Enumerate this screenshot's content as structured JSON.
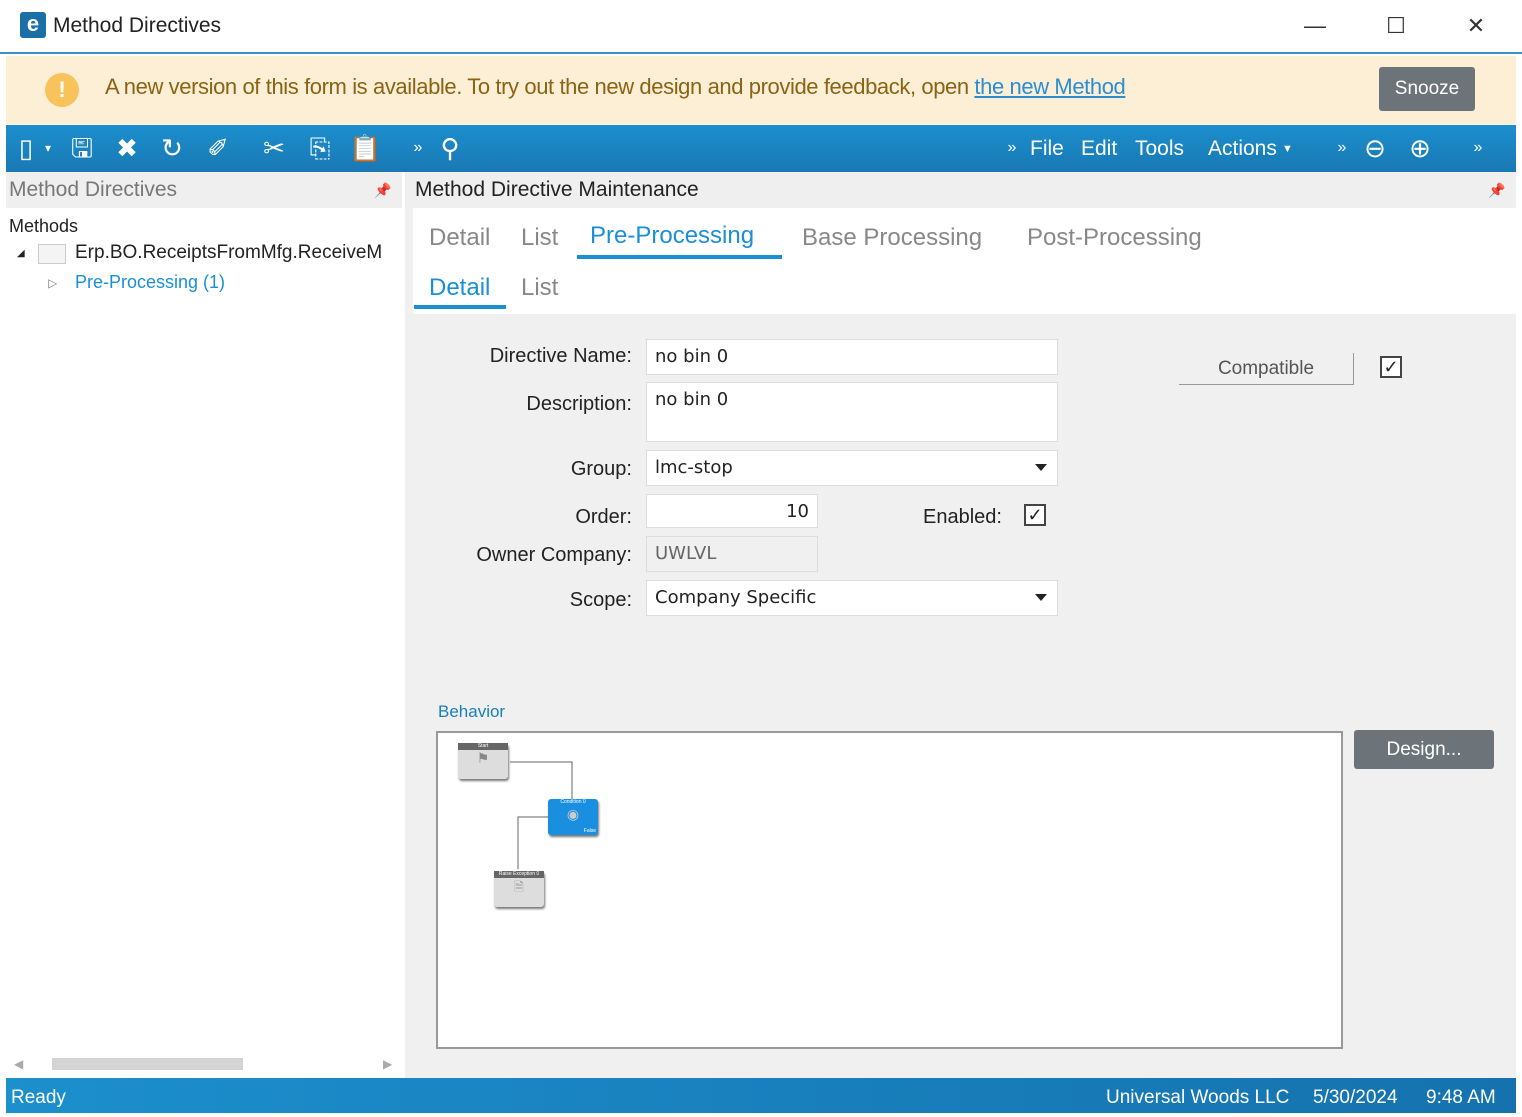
{
  "window": {
    "title": "Method Directives",
    "minimize": "—",
    "maximize": "☐",
    "close": "✕"
  },
  "banner": {
    "text": "A new version of this form is available. To try out the new design and provide feedback, open ",
    "link": "the new Method",
    "snooze": "Snooze"
  },
  "toolbar": {
    "menus": [
      "File",
      "Edit",
      "Tools",
      "Actions"
    ]
  },
  "left_panel": {
    "title": "Method Directives",
    "tree_root": "Methods",
    "tree_item": "Erp.BO.ReceiptsFromMfg.ReceiveM",
    "tree_child": "Pre-Processing (1)"
  },
  "main": {
    "title": "Method Directive Maintenance",
    "tabs": [
      "Detail",
      "List",
      "Pre-Processing",
      "Base Processing",
      "Post-Processing"
    ],
    "subtabs": [
      "Detail",
      "List"
    ],
    "form": {
      "directive_name_label": "Directive Name:",
      "directive_name": "no bin 0",
      "description_label": "Description:",
      "description": "no bin 0",
      "group_label": "Group:",
      "group": "lmc-stop",
      "order_label": "Order:",
      "order": "10",
      "enabled_label": "Enabled:",
      "enabled": true,
      "owner_label": "Owner Company:",
      "owner": "UWLVL",
      "scope_label": "Scope:",
      "scope": "Company Specific",
      "compatible": "Compatible",
      "compatible_checked": true
    },
    "behavior": {
      "label": "Behavior",
      "design_button": "Design...",
      "nodes": [
        "Start",
        "Condition 0",
        "Raise Exception 0"
      ],
      "false_label": "False"
    }
  },
  "status": {
    "text": "Ready",
    "company": "Universal Woods LLC",
    "date": "5/30/2024",
    "time": "9:48 AM"
  }
}
